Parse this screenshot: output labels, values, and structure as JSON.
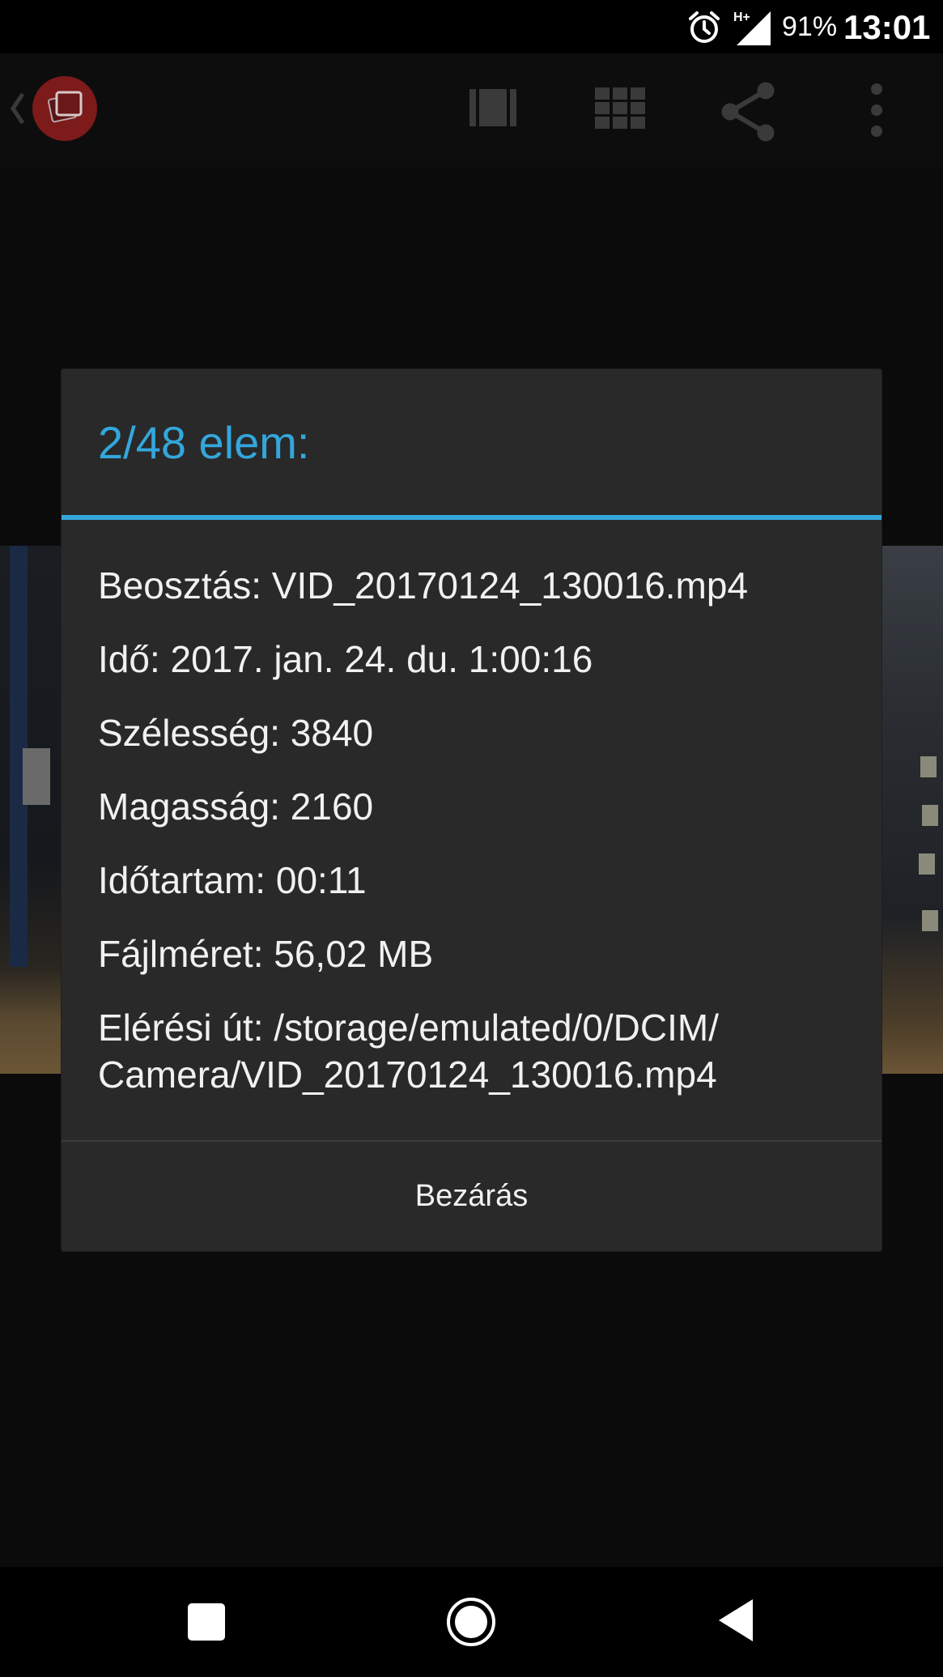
{
  "status_bar": {
    "network_label": "H+",
    "battery": "91%",
    "time": "13:01",
    "icons": [
      "alarm-icon",
      "signal-icon"
    ]
  },
  "action_bar": {
    "icons": [
      "back-chevron-icon",
      "app-logo-icon",
      "filmstrip-icon",
      "grid-icon",
      "share-icon",
      "more-vert-icon"
    ]
  },
  "dialog": {
    "title": "2/48 elem:",
    "rows": [
      "Beosztás: VID_20170124_130016.mp4",
      "Idő: 2017. jan. 24. du. 1:00:16",
      "Szélesség: 3840",
      "Magasság: 2160",
      "Időtartam: 00:11",
      "Fájlméret: 56,02 MB",
      "Elérési út: /storage/emulated/0/DCIM/ Camera/VID_20170124_130016.mp4"
    ],
    "close_label": "Bezárás",
    "accent_color": "#33a7dc"
  },
  "nav_bar": {
    "icons": [
      "recents-icon",
      "home-icon",
      "back-icon"
    ]
  }
}
